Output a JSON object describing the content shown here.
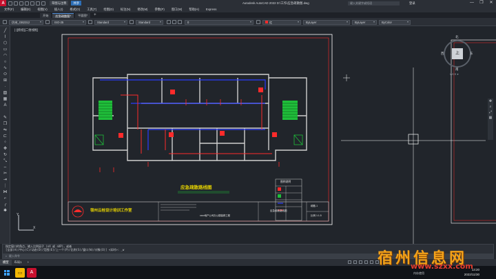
{
  "window": {
    "app_logo": "A",
    "workspace": "草图与注释",
    "share": "共享",
    "title": "Autodesk AutoCAD 2022   D:\\工作\\应急疏散图.dwg",
    "search_placeholder": "键入关键字或短语",
    "signin": "登录",
    "controls": [
      "—",
      "❐",
      "✕"
    ]
  },
  "menu": [
    "文件(F)",
    "编辑(E)",
    "视图(V)",
    "插入(I)",
    "格式(O)",
    "工具(T)",
    "绘图(D)",
    "标注(N)",
    "修改(M)",
    "参数(P)",
    "窗口(W)",
    "帮助(H)",
    "Express"
  ],
  "tabs": [
    {
      "label": "开始"
    },
    {
      "label": "应急疏散图*",
      "active": true
    },
    {
      "label": "平面图*"
    }
  ],
  "tab_add": "+",
  "properties": {
    "text_style": "仿宋_GB2312",
    "dim_style": "ISO-25",
    "table_style": "Standard",
    "mleader_style": "Standard",
    "layer": "0",
    "color_label": "红",
    "color": "#ff2b2b",
    "linetype": "ByLayer",
    "lineweight": "ByLayer",
    "plotstyle": "ByColor"
  },
  "viewport_label": "[-][俯视][二维线框]",
  "viewcube": {
    "top": "上",
    "north": "北",
    "south": "南",
    "west": "西",
    "east": "东",
    "wcs": "WCS ▾"
  },
  "navbar_icons": [
    "✥",
    "⌕",
    "⤢",
    "▦"
  ],
  "drawing": {
    "plan_title": "应急疏散路线图",
    "legend_title": "图例说明",
    "company": "宿州云桂设计培训工作室",
    "project": "xxxx地产公司办公楼装修工程",
    "sheet_name": "应急疏散路线图",
    "sheet_no": "疏散-1",
    "scale": "比例 1:1.5"
  },
  "cmd_history": [
    "指定窗口的角点，输入比例因子 (nX 或 nXP)，或者",
    "[全部(A)/中心(C)/动态(D)/范围(E)/上一个(P)/比例(S)/窗口(W)/对象(O)] <实时>: _w"
  ],
  "cmd_placeholder": "▸ 键入命令",
  "layout_tabs": [
    {
      "label": "模型",
      "active": true
    },
    {
      "label": "布局1"
    },
    {
      "label": "+"
    }
  ],
  "taskbar": {
    "start_icon": "windows-start",
    "time": "13:20",
    "date": "2022/11/30",
    "tray_text": "内存使用"
  },
  "watermark": {
    "cn": "宿州信息网",
    "url": "www.szxx.com"
  }
}
